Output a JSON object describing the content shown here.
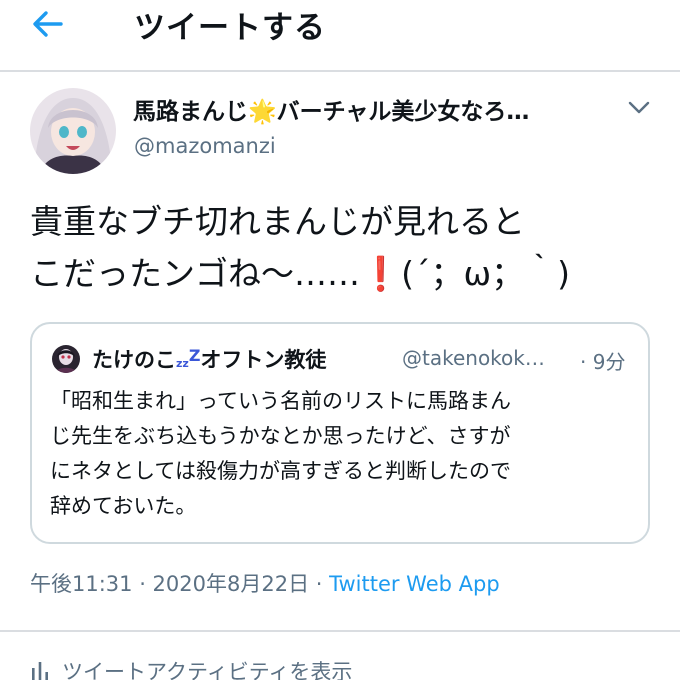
{
  "header": {
    "title": "ツイートする",
    "back_icon": "arrow-left-icon"
  },
  "tweet": {
    "display_name": "馬路まんじ🌟バーチャル美少女なろ…",
    "handle": "@mazomanzi",
    "text_line1": "貴重なブチ切れまんじが見れると",
    "text_line2_main": "こだったンゴね〜……",
    "text_line2_emoji": "❗",
    "text_line2_face": "(´；ω；｀)",
    "menu_icon": "chevron-down-icon"
  },
  "quoted_tweet": {
    "name_part1": "たけのこ",
    "name_zz": "zz",
    "name_z": "Z",
    "name_part2": "オフトン教徒",
    "handle": "@takenokok…",
    "time": "· 9分",
    "text": "「昭和生まれ」っていう名前のリストに馬路まん\nじ先生をぶち込もうかなとか思ったけど、さすが\nにネタとしては殺傷力が高すぎると判断したので\n辞めておいた。"
  },
  "meta": {
    "time": "午後11:31 · 2020年8月22日 · ",
    "app": "Twitter Web App"
  },
  "activity": {
    "label": "ツイートアクティビティを表示",
    "icon": "bar-chart-icon"
  },
  "colors": {
    "accent": "#1d9bf0",
    "secondary_text": "#5b7083",
    "border": "#cfd9de"
  }
}
